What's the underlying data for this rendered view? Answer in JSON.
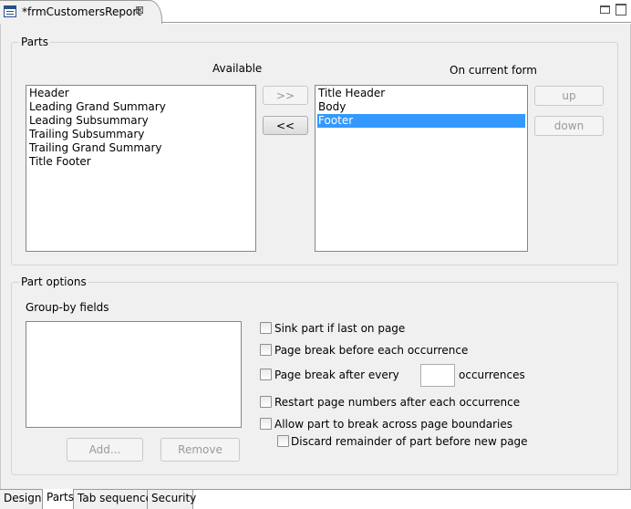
{
  "editor": {
    "tab_title": "*frmCustomersReport",
    "tab_icon": "form-icon",
    "close_glyph": "⊠"
  },
  "parts": {
    "group_title": "Parts",
    "available_label": "Available",
    "current_label": "On current form",
    "available_items": [
      "Header",
      "Leading Grand Summary",
      "Leading Subsummary",
      "Trailing Subsummary",
      "Trailing Grand Summary",
      "Title Footer"
    ],
    "current_items": [
      "Title Header",
      "Body",
      "Footer"
    ],
    "selected_current": "Footer",
    "add_label": ">>",
    "remove_label": "<<",
    "up_label": "up",
    "down_label": "down"
  },
  "part_options": {
    "group_title": "Part options",
    "groupby_label": "Group-by fields",
    "add_label": "Add...",
    "remove_label": "Remove",
    "sink_label": "Sink part if last on page",
    "page_break_before_label": "Page break before each occurrence",
    "page_break_after_label": "Page break after every",
    "page_break_after_value": "",
    "occurrences_label": "occurrences",
    "restart_label": "Restart page numbers after each occurrence",
    "allow_break_label": "Allow part to break across page boundaries",
    "discard_label": "Discard remainder of part before new page",
    "sink_checked": false,
    "page_break_before_checked": false,
    "page_break_after_checked": false,
    "restart_checked": false,
    "allow_break_checked": false,
    "discard_checked": false
  },
  "bottom_tabs": [
    {
      "label": "Design",
      "active": false
    },
    {
      "label": "Parts",
      "active": true
    },
    {
      "label": "Tab sequence",
      "active": false
    },
    {
      "label": "Security",
      "active": false
    }
  ],
  "colors": {
    "selection": "#3399ff",
    "panel_background": "#f0f0f0"
  }
}
